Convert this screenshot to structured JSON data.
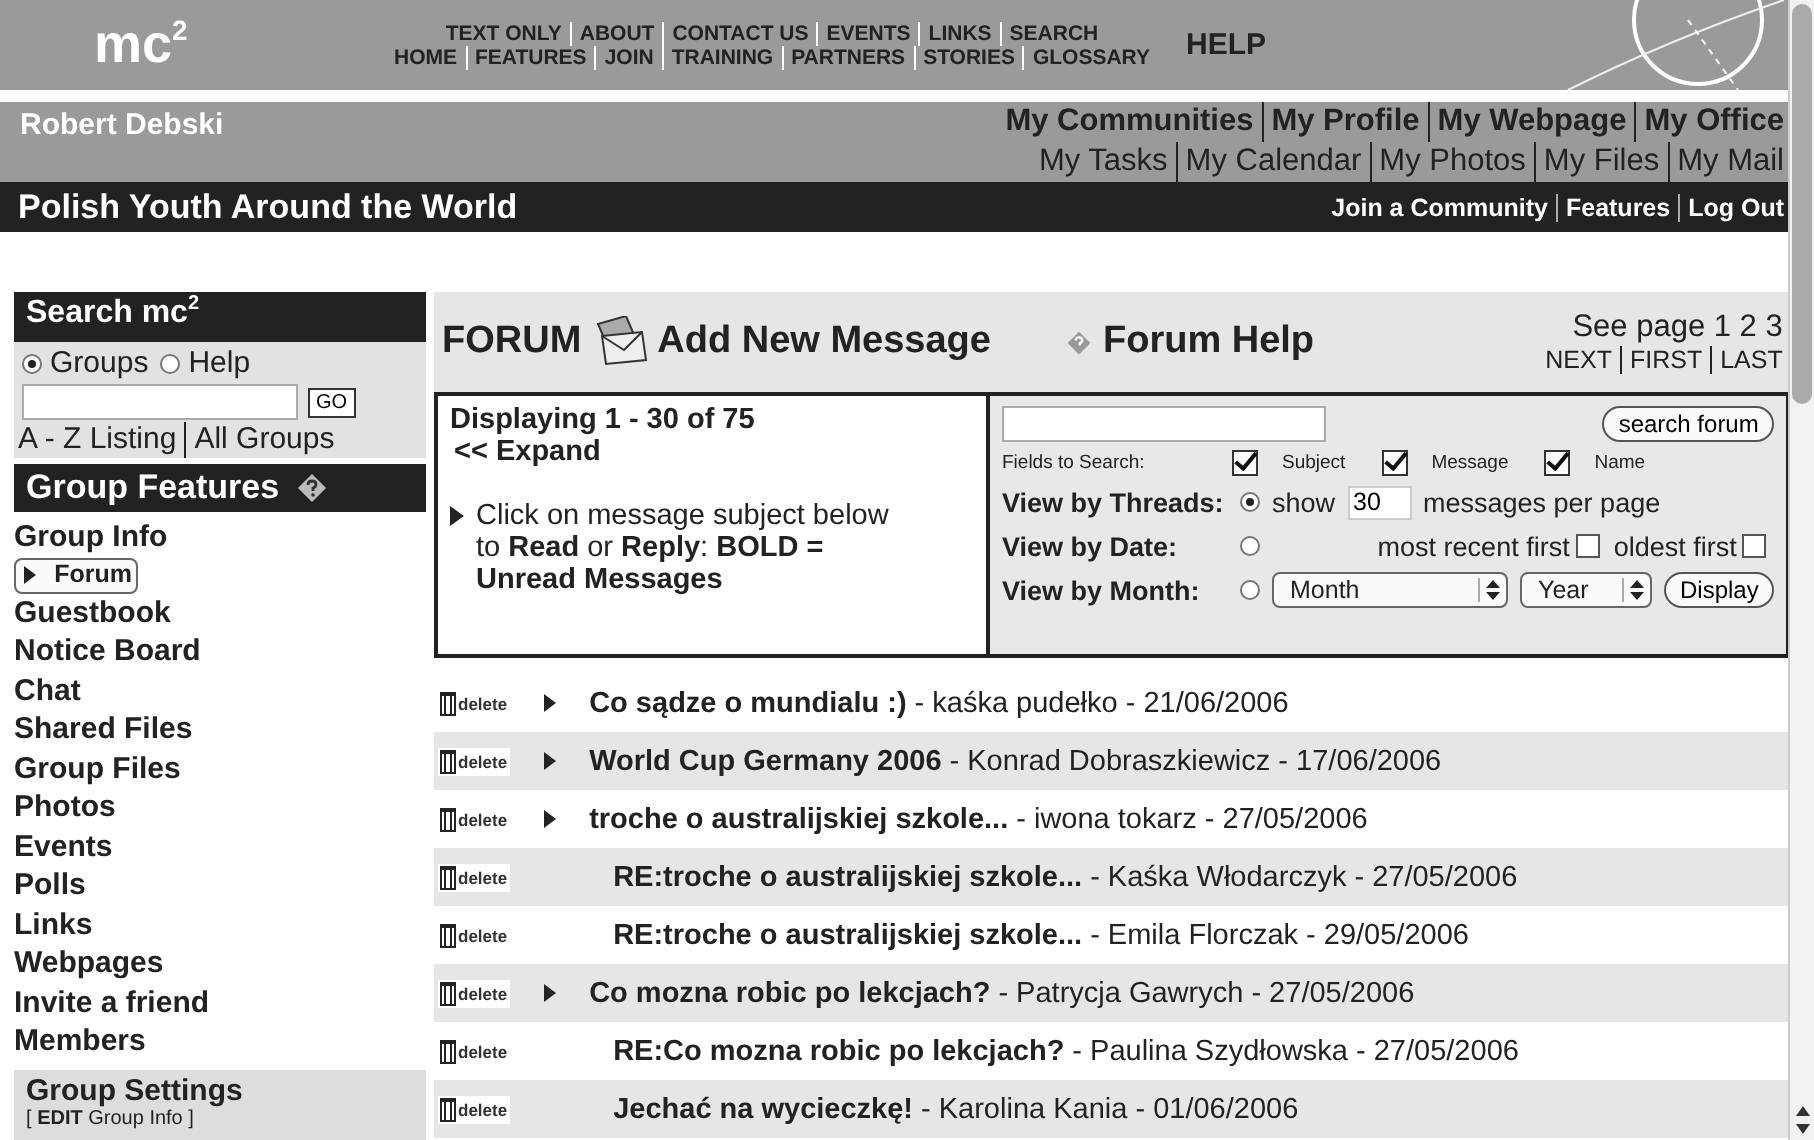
{
  "header": {
    "logo": "mc$^{2}$",
    "nav_rows": [
      [
        "TEXT ONLY",
        "ABOUT",
        "CONTACT US",
        "EVENTS",
        "LINKS",
        "SEARCH"
      ],
      [
        "HOME",
        "FEATURES",
        "JOIN",
        "TRAINING",
        "PARTNERS",
        "STORIES",
        "GLOSSARY"
      ]
    ],
    "help": "HELP"
  },
  "user_bar": {
    "name": "Robert Debski",
    "primary_links": [
      "My Communities",
      "My Profile",
      "My Webpage",
      "My Office"
    ],
    "secondary_links": [
      "My Tasks",
      "My Calendar",
      "My Photos",
      "My Files",
      "My Mail"
    ]
  },
  "group_bar": {
    "title": "Polish Youth Around the World",
    "links": [
      "Join a Community",
      "Features",
      "Log Out"
    ]
  },
  "sidebar": {
    "search_title": "Search mc$^{2}$",
    "search_scopes": [
      {
        "label": "Groups",
        "selected": true
      },
      {
        "label": "Help",
        "selected": false
      }
    ],
    "go": "GO",
    "listing_links": [
      "A - Z Listing",
      "All Groups"
    ],
    "features_title": "Group Features",
    "features": [
      {
        "label": "Group Info",
        "selected": false
      },
      {
        "label": "Forum",
        "selected": true
      },
      {
        "label": "Guestbook",
        "selected": false
      },
      {
        "label": "Notice Board",
        "selected": false
      },
      {
        "label": "Chat",
        "selected": false
      },
      {
        "label": "Shared Files",
        "selected": false
      },
      {
        "label": "Group Files",
        "selected": false
      },
      {
        "label": "Photos",
        "selected": false
      },
      {
        "label": "Events",
        "selected": false
      },
      {
        "label": "Polls",
        "selected": false
      },
      {
        "label": "Links",
        "selected": false
      },
      {
        "label": "Webpages",
        "selected": false
      },
      {
        "label": "Invite a friend",
        "selected": false
      },
      {
        "label": "Members",
        "selected": false
      }
    ],
    "settings_title": "Group Settings",
    "settings_link": "[ **EDIT** Group Info ]"
  },
  "forum": {
    "title": "FORUM",
    "add_message": "Add New Message",
    "help": "Forum Help",
    "see_page": "See page 1 2 3",
    "page_links": [
      "NEXT",
      "FIRST",
      "LAST"
    ],
    "displaying": "Displaying 1 - 30 of 75",
    "expand": "<< Expand",
    "instructions": "Click on message subject below to **Read** or **Reply**: **BOLD = Unread Messages**",
    "search_button": "search forum",
    "fields_label": "Fields to Search:",
    "fields": [
      {
        "label": "Subject",
        "checked": true
      },
      {
        "label": "Message",
        "checked": true
      },
      {
        "label": "Name",
        "checked": true
      }
    ],
    "view_threads": {
      "label": "View by Threads:",
      "selected": true,
      "show": "show",
      "count": "30",
      "suffix": "messages per page"
    },
    "view_date": {
      "label": "View by Date:",
      "selected": false,
      "options": [
        {
          "label": "most recent first",
          "checked": false
        },
        {
          "label": "oldest first",
          "checked": false
        }
      ]
    },
    "view_month": {
      "label": "View by Month:",
      "selected": false,
      "month": "Month",
      "year": "Year",
      "button": "Display"
    }
  },
  "messages": [
    {
      "kind": "thread",
      "delete": "delete",
      "subject": "Co sądze o mundialu :)",
      "meta": "- kaśka pudełko - 21/06/2006"
    },
    {
      "kind": "thread",
      "delete": "delete",
      "subject": "World Cup Germany 2006",
      "meta": "- Konrad Dobraszkiewicz - 17/06/2006"
    },
    {
      "kind": "thread",
      "delete": "delete",
      "subject": "troche o australijskiej szkole...",
      "meta": "- iwona tokarz - 27/05/2006"
    },
    {
      "kind": "reply",
      "delete": "delete",
      "subject": "RE:troche o australijskiej szkole...",
      "meta": "- Kaśka Włodarczyk - 27/05/2006"
    },
    {
      "kind": "reply",
      "delete": "delete",
      "subject": "RE:troche o australijskiej szkole...",
      "meta": "- Emila Florczak - 29/05/2006"
    },
    {
      "kind": "thread",
      "delete": "delete",
      "subject": "Co mozna robic po lekcjach?",
      "meta": "- Patrycja Gawrych - 27/05/2006"
    },
    {
      "kind": "reply",
      "delete": "delete",
      "subject": "RE:Co mozna robic po lekcjach?",
      "meta": "- Paulina Szydłowska - 27/05/2006"
    },
    {
      "kind": "reply",
      "delete": "delete",
      "subject": "Jechać na wycieczkę!",
      "meta": "- Karolina Kania - 01/06/2006"
    }
  ]
}
